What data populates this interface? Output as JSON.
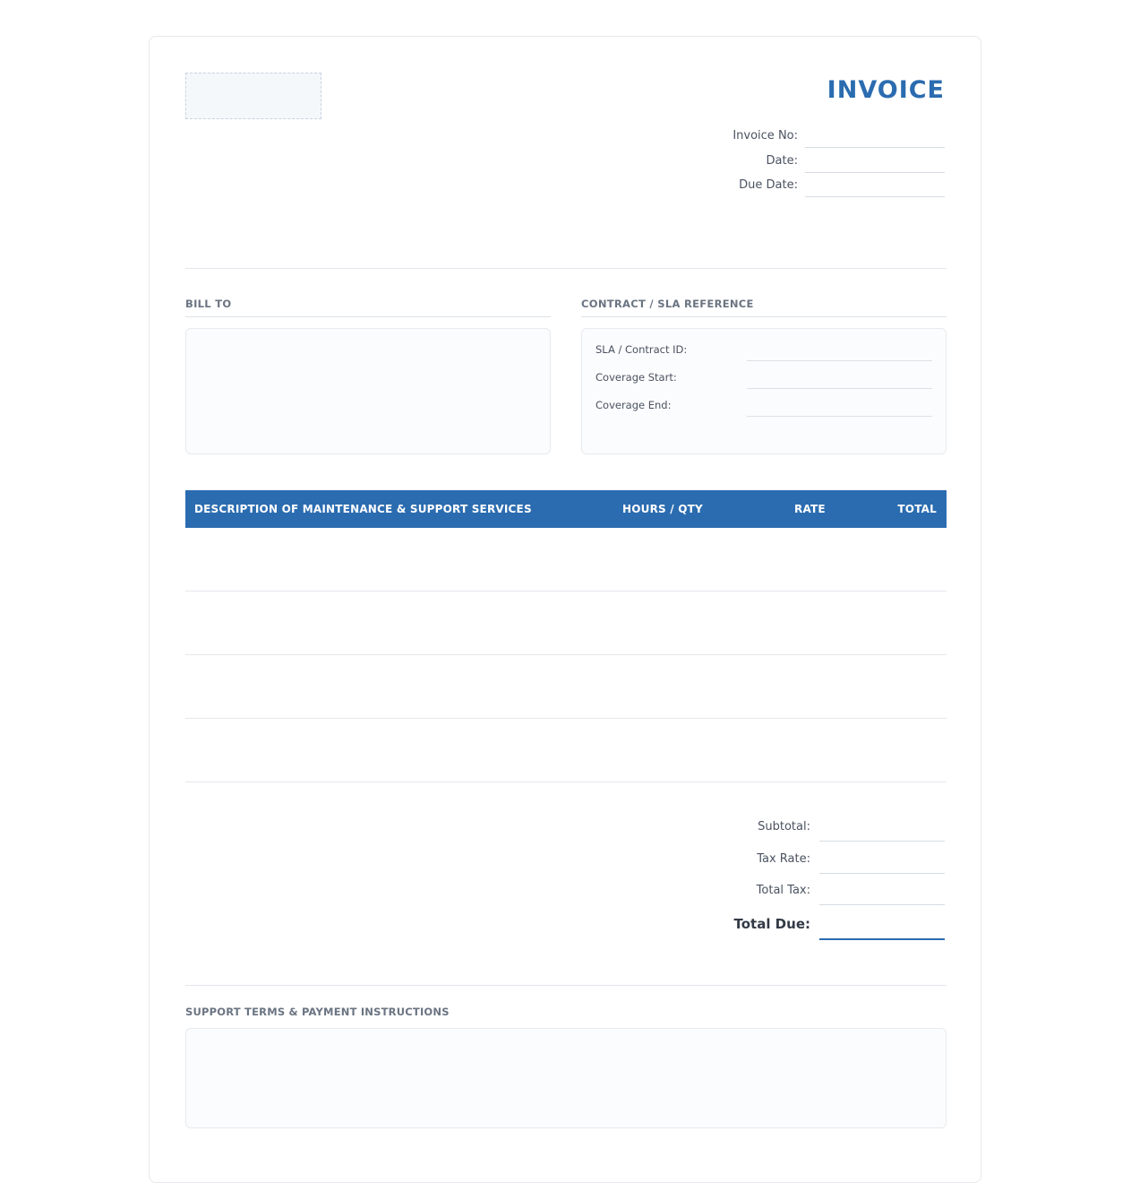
{
  "header": {
    "title": "INVOICE",
    "fields": [
      {
        "label": "Invoice No:",
        "value": ""
      },
      {
        "label": "Date:",
        "value": ""
      },
      {
        "label": "Due Date:",
        "value": ""
      }
    ]
  },
  "bill_to": {
    "label": "BILL TO",
    "content": ""
  },
  "contract": {
    "label": "CONTRACT / SLA REFERENCE",
    "fields": [
      {
        "label": "SLA / Contract ID:",
        "value": ""
      },
      {
        "label": "Coverage Start:",
        "value": ""
      },
      {
        "label": "Coverage End:",
        "value": ""
      }
    ]
  },
  "table": {
    "columns": [
      "DESCRIPTION OF MAINTENANCE & SUPPORT SERVICES",
      "HOURS / QTY",
      "RATE",
      "TOTAL"
    ],
    "rows": [
      [
        "",
        "",
        "",
        ""
      ],
      [
        "",
        "",
        "",
        ""
      ],
      [
        "",
        "",
        "",
        ""
      ],
      [
        "",
        "",
        "",
        ""
      ]
    ]
  },
  "totals": [
    {
      "label": "Subtotal:",
      "value": ""
    },
    {
      "label": "Tax Rate:",
      "value": ""
    },
    {
      "label": "Total Tax:",
      "value": ""
    },
    {
      "label": "Total Due:",
      "value": ""
    }
  ],
  "terms": {
    "label": "SUPPORT TERMS & PAYMENT INSTRUCTIONS",
    "content": ""
  },
  "colors": {
    "accent": "#2b6cb0",
    "border": "#e5e8ec",
    "label_text": "#6b7482"
  }
}
